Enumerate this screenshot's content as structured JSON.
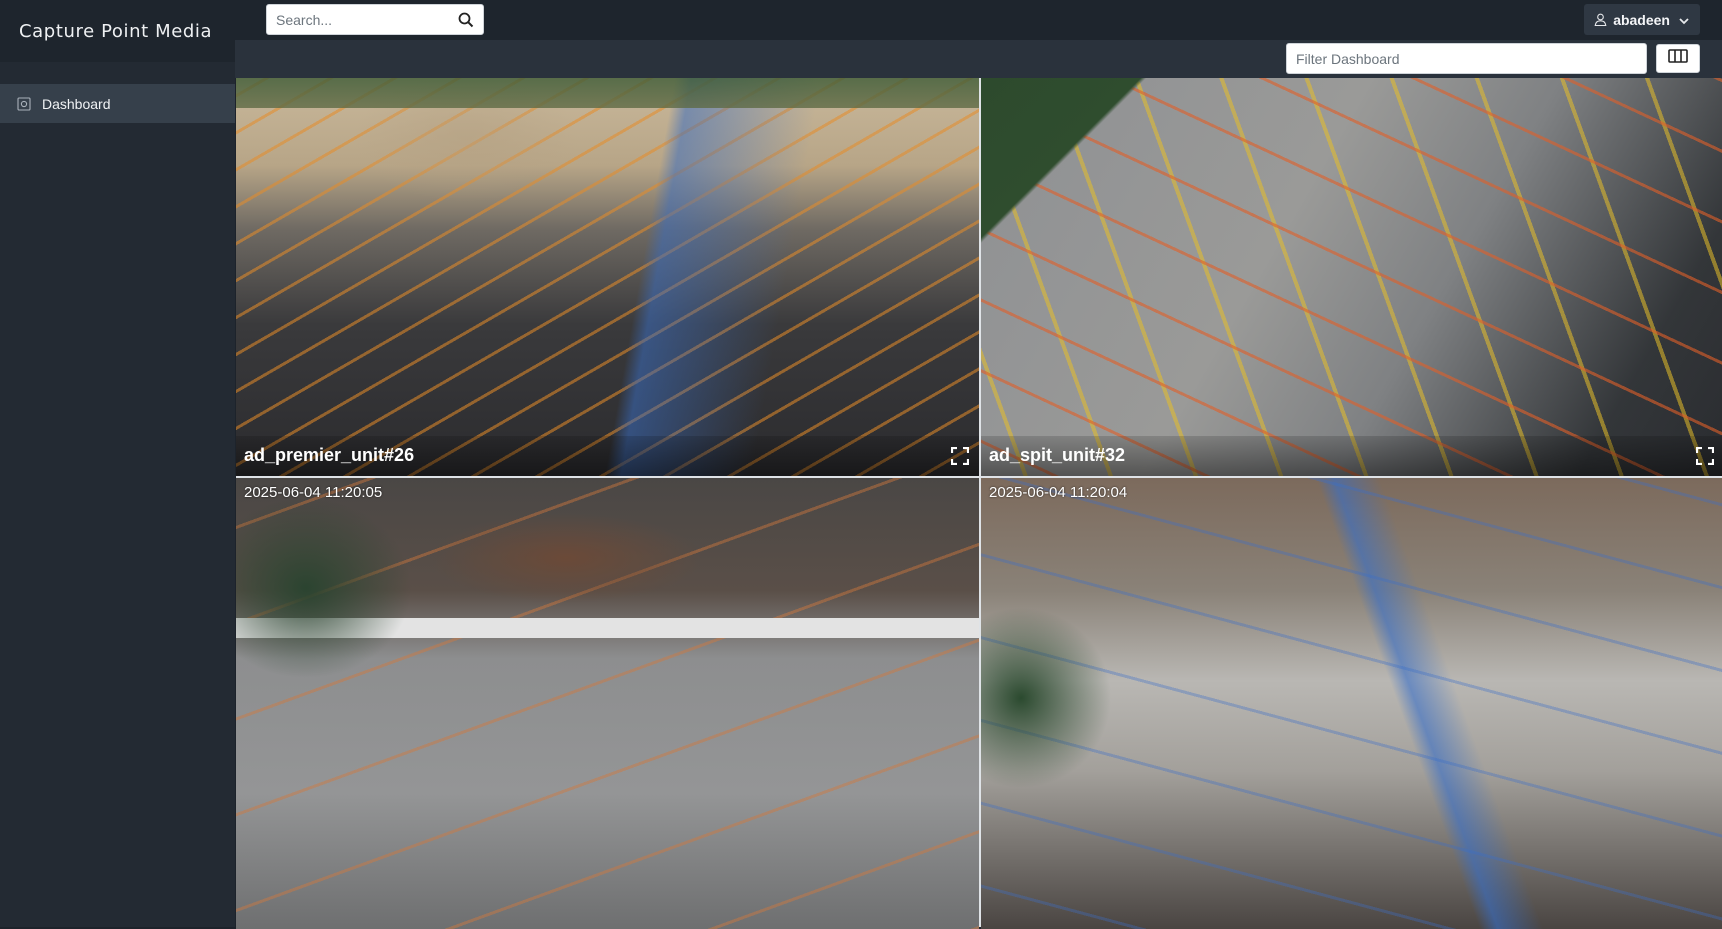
{
  "app": {
    "title": "Capture Point Media"
  },
  "sidebar": {
    "items": [
      {
        "label": "Dashboard",
        "icon": "camera-icon"
      }
    ]
  },
  "header": {
    "search": {
      "placeholder": "Search...",
      "value": ""
    },
    "user": {
      "name": "abadeen"
    }
  },
  "toolbar": {
    "filter": {
      "placeholder": "Filter Dashboard",
      "value": ""
    },
    "layout_icon": "columns-icon"
  },
  "cameras": [
    {
      "name": "ad_premier_unit#26",
      "timestamp": ""
    },
    {
      "name": "ad_spit_unit#32",
      "timestamp": ""
    },
    {
      "name": "",
      "timestamp": "2025-06-04 11:20:05"
    },
    {
      "name": "",
      "timestamp": "2025-06-04 11:20:04"
    }
  ]
}
